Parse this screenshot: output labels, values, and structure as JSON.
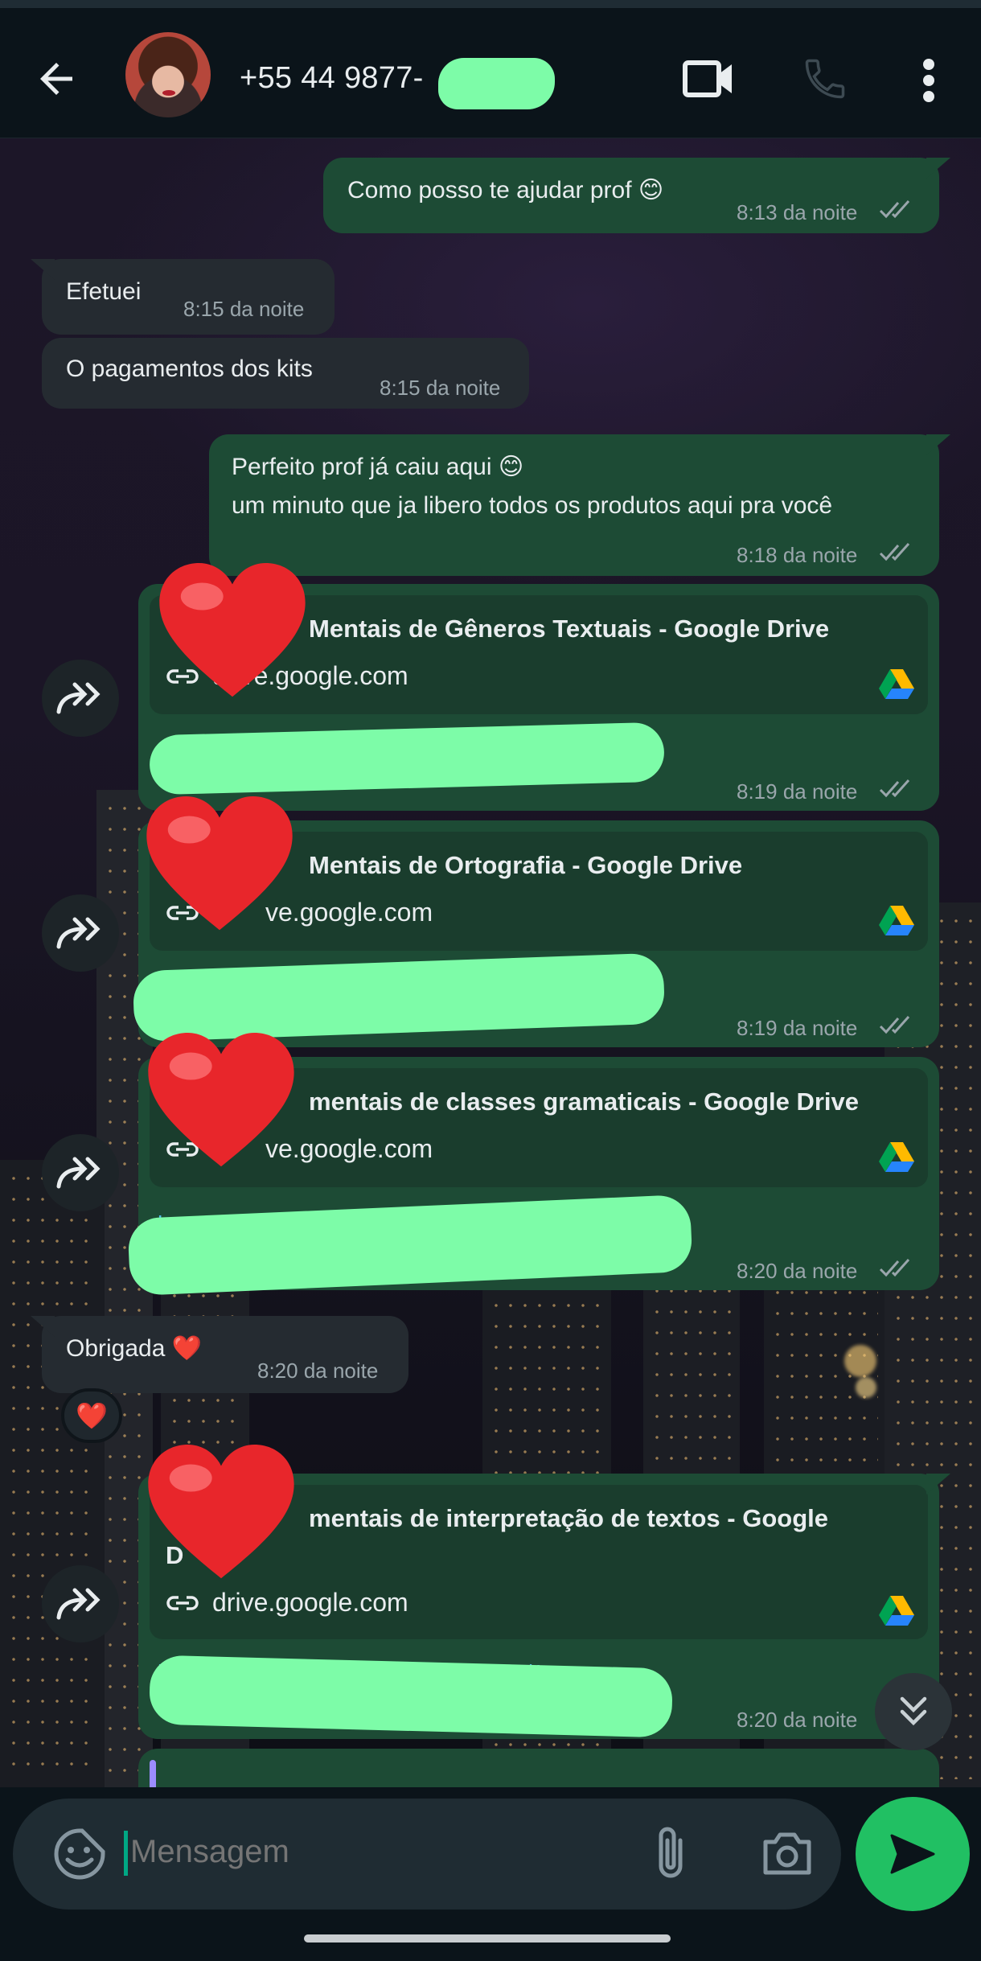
{
  "header": {
    "contact_name": "+55 44 9877-",
    "icons": [
      "back-arrow-icon",
      "video-call-icon",
      "phone-call-icon",
      "more-vert-icon"
    ]
  },
  "messages": [
    {
      "id": "m1",
      "direction": "out",
      "text": "Como posso te ajudar prof 😊",
      "time": "8:13 da noite",
      "status": "read"
    },
    {
      "id": "m2",
      "direction": "in",
      "text": "Efetuei",
      "time": "8:15 da noite"
    },
    {
      "id": "m3",
      "direction": "in",
      "text": "O pagamentos dos kits",
      "time": "8:15 da noite"
    },
    {
      "id": "m4",
      "direction": "out",
      "line1": "Perfeito prof já caiu aqui 😊",
      "line2": "um minuto que ja libero todos os produtos aqui pra você",
      "time": "8:18 da noite",
      "status": "read"
    },
    {
      "id": "m5",
      "direction": "out",
      "link_title": "Mentais de Gêneros Textuais - Google Drive",
      "link_domain": "drive.google.com",
      "time": "8:19 da noite",
      "status": "read"
    },
    {
      "id": "m6",
      "direction": "out",
      "link_title": "Mentais de Ortografia - Google Drive",
      "link_domain": "ve.google.com",
      "time": "8:19 da noite",
      "status": "read"
    },
    {
      "id": "m7",
      "direction": "out",
      "link_title": "mentais de classes gramaticais - Google Drive",
      "link_domain": "ve.google.com",
      "time": "8:20 da noite",
      "status": "read"
    },
    {
      "id": "m8",
      "direction": "in",
      "text": "Obrigada ❤️",
      "time": "8:20 da noite",
      "reaction": "❤️"
    },
    {
      "id": "m9",
      "direction": "out",
      "link_title": "mentais de interpretação de textos - Google",
      "link_title_line2": "D",
      "link_domain": "drive.google.com",
      "time": "8:20 da noite"
    }
  ],
  "composer": {
    "placeholder": "Mensagem",
    "icons": [
      "sticker-icon",
      "attach-icon",
      "camera-icon",
      "send-icon"
    ]
  },
  "colors": {
    "outgoing_bubble": "#1d4b35",
    "incoming_bubble": "#252b31",
    "link_preview": "#1a3d2d",
    "accent_green": "#21c063",
    "redaction": "#7dfca8",
    "read_ticks": "#9aa6ac"
  }
}
